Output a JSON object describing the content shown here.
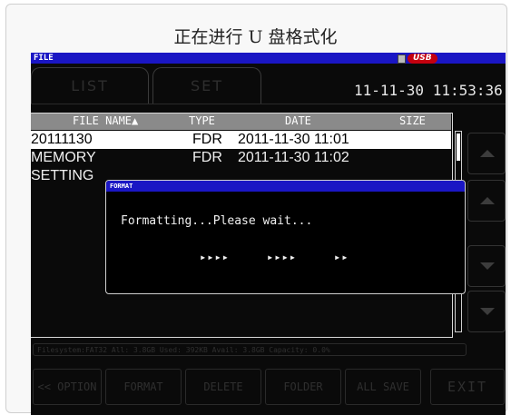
{
  "caption": "正在进行 U 盘格式化",
  "screen_title": "FILE",
  "usb_badge": "USB",
  "tabs": [
    {
      "label": "LIST"
    },
    {
      "label": "SET"
    }
  ],
  "clock": "11-11-30 11:53:36",
  "columns": {
    "name": "FILE NAME▲",
    "type": "TYPE",
    "date": "DATE",
    "size": "SIZE"
  },
  "files": [
    {
      "name": "20111130",
      "type": "FDR",
      "date": "2011-11-30 11:01",
      "selected": true
    },
    {
      "name": "MEMORY",
      "type": "FDR",
      "date": "2011-11-30 11:02",
      "selected": false
    },
    {
      "name": "SETTING",
      "type": "",
      "date": "",
      "selected": false
    }
  ],
  "status_line": "Filesystem:FAT32 All: 3.8GB Used: 392KB Avail: 3.8GB Capacity: 0.0%",
  "dialog": {
    "title": "FORMAT",
    "message": "Formatting...Please wait...",
    "progress": "▸▸▸▸     ▸▸▸▸     ▸▸"
  },
  "buttons": {
    "option": "<< OPTION",
    "format": "FORMAT",
    "delete": "DELETE",
    "folder": "FOLDER",
    "all_save": "ALL SAVE",
    "exit": "EXIT"
  },
  "colors": {
    "title_bar": "#1a16c4",
    "usb_badge": "#c4000f",
    "screen_bg": "#0a0a0a"
  },
  "icons": [
    "usb-drive-icon",
    "scroll-up-icon",
    "scroll-down-icon"
  ]
}
